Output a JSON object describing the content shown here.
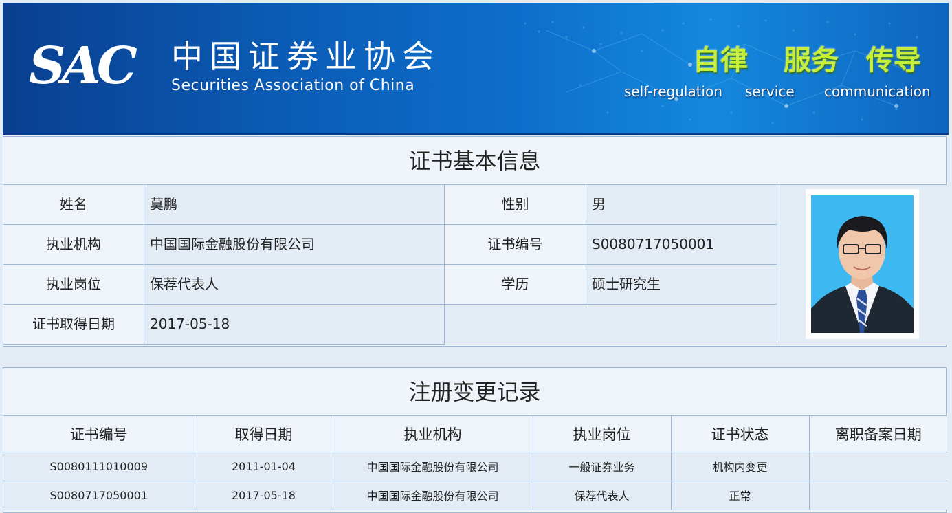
{
  "banner": {
    "logo": "SAC",
    "org_cn": "中国证券业协会",
    "org_en": "Securities Association of China",
    "slogans": [
      {
        "cn": "自律",
        "en": "self-regulation"
      },
      {
        "cn": "服务",
        "en": "service"
      },
      {
        "cn": "传导",
        "en": "communication"
      }
    ]
  },
  "basic": {
    "title": "证书基本信息",
    "name_label": "姓名",
    "name": "莫鹏",
    "gender_label": "性别",
    "gender": "男",
    "org_label": "执业机构",
    "org": "中国国际金融股份有限公司",
    "cert_label": "证书编号",
    "cert": "S0080717050001",
    "post_label": "执业岗位",
    "post": "保荐代表人",
    "edu_label": "学历",
    "edu": "硕士研究生",
    "date_label": "证书取得日期",
    "date": "2017-05-18"
  },
  "records": {
    "title": "注册变更记录",
    "headers": [
      "证书编号",
      "取得日期",
      "执业机构",
      "执业岗位",
      "证书状态",
      "离职备案日期"
    ],
    "rows": [
      [
        "S0080111010009",
        "2011-01-04",
        "中国国际金融股份有限公司",
        "一般证券业务",
        "机构内变更",
        ""
      ],
      [
        "S0080717050001",
        "2017-05-18",
        "中国国际金融股份有限公司",
        "保荐代表人",
        "正常",
        ""
      ]
    ]
  },
  "colors": {
    "banner_blue": "#0b5cb6",
    "slogan_green": "#c6ee3a",
    "border": "#9bb7d7",
    "panel_bg": "#eef4f9",
    "value_bg": "#e3ebf4"
  }
}
